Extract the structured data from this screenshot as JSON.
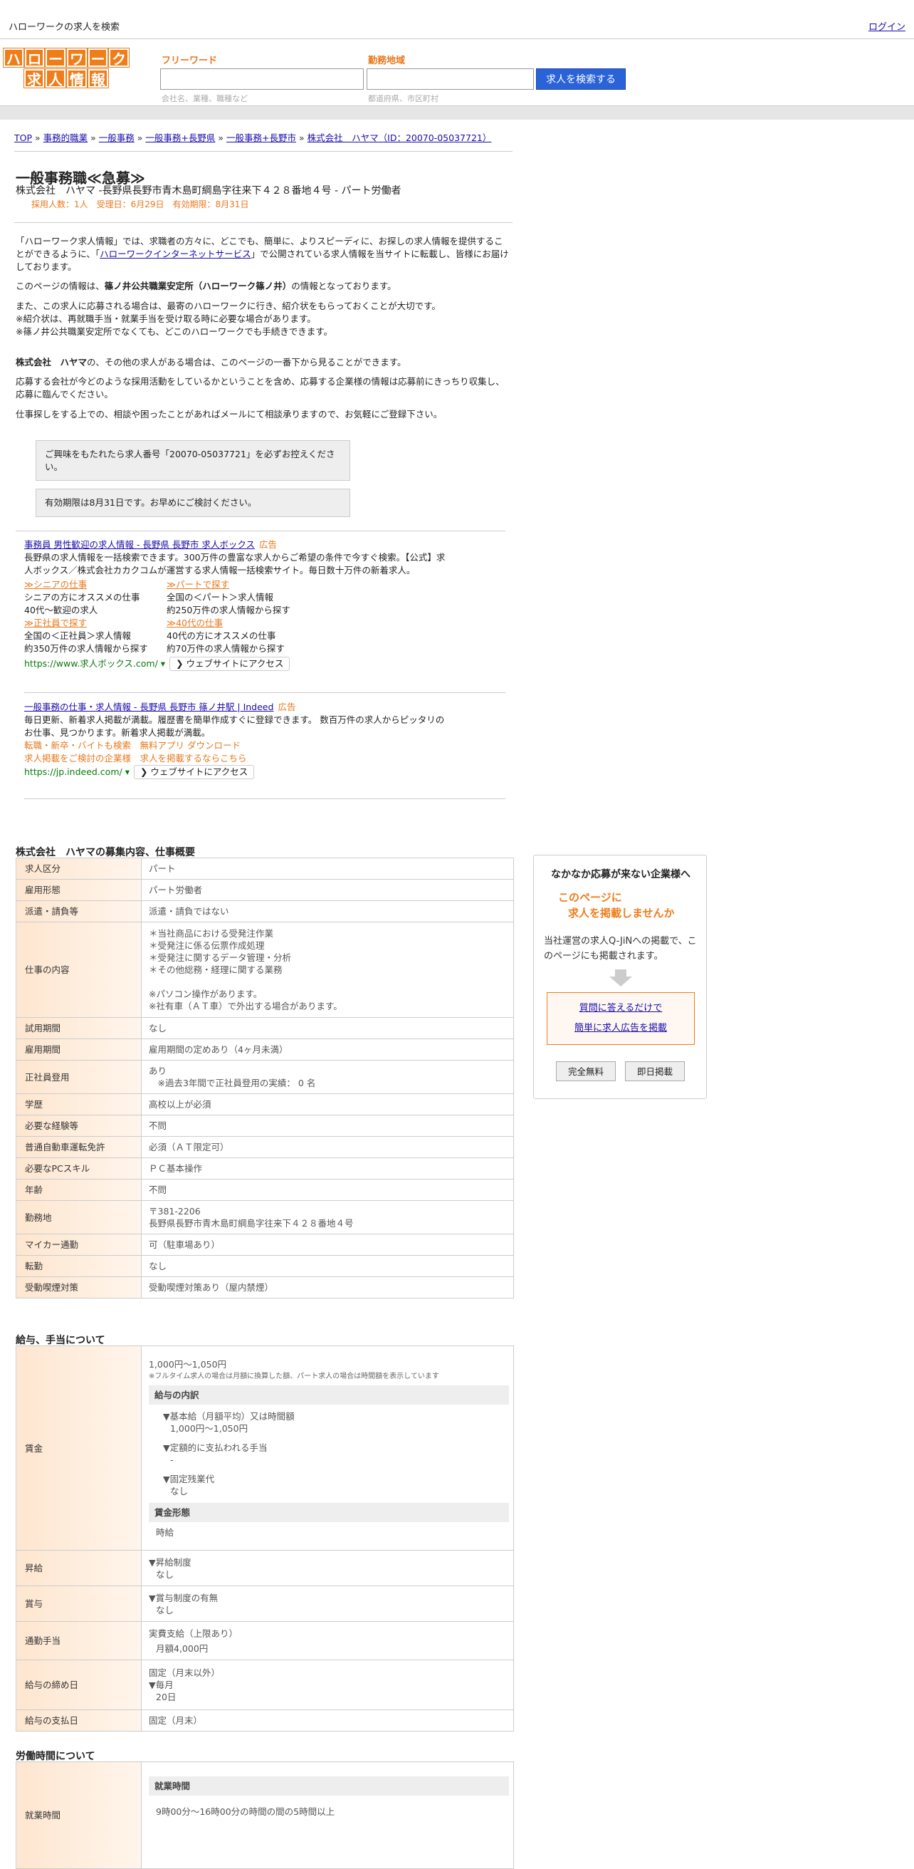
{
  "topbar": {
    "title": "ハローワークの求人を検索",
    "login": "ログイン"
  },
  "logo": {
    "row1": [
      "ハ",
      "ロ",
      "ー",
      "ワ",
      "ー",
      "ク"
    ],
    "row2": [
      "求",
      "人",
      "情",
      "報"
    ]
  },
  "search": {
    "freeword_label": "フリーワード",
    "freeword_placeholder": "会社名、業種、職種など",
    "area_label": "勤務地域",
    "area_placeholder": "都道府県、市区町村",
    "button": "求人を検索する"
  },
  "breadcrumb": [
    {
      "label": "TOP"
    },
    {
      "label": "事務的職業"
    },
    {
      "label": "一般事務"
    },
    {
      "label": "一般事務+長野県"
    },
    {
      "label": "一般事務+長野市"
    },
    {
      "label": "株式会社　ハヤマ（ID：20070-05037721）"
    }
  ],
  "breadcrumb_sep": "»",
  "job": {
    "title": "一般事務職≪急募≫",
    "company_line": "株式会社　ハヤマ -長野県長野市青木島町綱島字往来下４２８番地４号 - パート労働者",
    "meta": "採用人数：1人　受理日：6月29日　有効期限：8月31日"
  },
  "intro": {
    "p1a": "「ハローワーク求人情報」では、求職者の方々に、どこでも、簡単に、よりスピーディに、お探しの求人情報を提供することができるように、「",
    "p1link": "ハローワークインターネットサービス",
    "p1b": "」で公開されている求人情報を当サイトに転載し、皆様にお届けしております。",
    "p2a": "このページの情報は、",
    "p2b": "篠ノ井公共職業安定所（ハローワーク篠ノ井）",
    "p2c": "の情報となっております。",
    "p3": "また、この求人に応募される場合は、最寄のハローワークに行き、紹介状をもらっておくことが大切です。",
    "p4": "※紹介状は、再就職手当・就業手当を受け取る時に必要な場合があります。",
    "p5": "※篠ノ井公共職業安定所でなくても、どこのハローワークでも手続きできます。",
    "p6a": "株式会社　ハヤマ",
    "p6b": "の、その他の求人がある場合は、このページの一番下から見ることができます。",
    "p7": "応募する会社が今どのような採用活動をしているかということを含め、応募する企業様の情報は応募前にきっちり収集し、応募に臨んでください。",
    "p8": "仕事探しをする上での、相談や困ったことがあればメールにて相談承りますので、お気軽にご登録下さい。",
    "box1": "ご興味をもたれたら求人番号「20070-05037721」を必ずお控えください。",
    "box2": "有効期限は8月31日です。お早めにご検討ください。"
  },
  "ads": [
    {
      "title": "事務員 男性歓迎の求人情報 - 長野県 長野市 求人ボックス",
      "badge": "広告",
      "desc": "長野県の求人情報を一括検索できます。300万件の豊富な求人からご希望の条件で今すぐ検索。【公式】求人ボックス／株式会社カカクコムが運営する求人情報一括検索サイト。毎日数十万件の新着求人。",
      "subs": [
        {
          "t": "≫シニアの仕事",
          "d1": "シニアの方にオススメの仕事",
          "d2": "40代～歓迎の求人"
        },
        {
          "t": "≫パートで探す",
          "d1": "全国の＜パート＞求人情報",
          "d2": "約250万件の求人情報から探す"
        },
        {
          "t": "≫正社員で探す",
          "d1": "全国の＜正社員＞求人情報",
          "d2": "約350万件の求人情報から探す"
        },
        {
          "t": "≫40代の仕事",
          "d1": "40代の方にオススメの仕事",
          "d2": "約70万件の求人情報から探す"
        }
      ],
      "url": "https://www.求人ボックス.com/",
      "btn": "ウェブサイトにアクセス"
    },
    {
      "title": "一般事務の仕事・求人情報 - 長野県 長野市 篠ノ井駅 | Indeed",
      "badge": "広告",
      "desc": "毎日更新、新着求人掲載が満載。履歴書を簡単作成すぐに登録できます。 数百万件の求人からピッタリのお仕事、見つかります。新着求人掲載が満載。",
      "links1": "転職・新卒・バイトも検索　無料アプリ ダウンロード",
      "links2": "求人掲載をご検討の企業様　求人を掲載するならこちら",
      "url": "https://jp.indeed.com/",
      "btn": "ウェブサイトにアクセス"
    }
  ],
  "sections": {
    "overview": "株式会社　ハヤマの募集内容、仕事概要",
    "salary": "給与、手当について",
    "hours": "労働時間について"
  },
  "overview_rows": [
    {
      "k": "求人区分",
      "v": [
        "パート"
      ]
    },
    {
      "k": "雇用形態",
      "v": [
        "パート労働者"
      ]
    },
    {
      "k": "派遣・請負等",
      "v": [
        "派遣・請負ではない"
      ]
    },
    {
      "k": "仕事の内容",
      "v": [
        "＊当社商品における受発注作業",
        "＊受発注に係る伝票作成処理",
        "＊受発注に関するデータ管理・分析",
        "＊その他総務・経理に関する業務",
        "",
        "※パソコン操作があります。",
        "※社有車（ＡＴ車）で外出する場合があります。"
      ]
    },
    {
      "k": "試用期間",
      "v": [
        "なし"
      ]
    },
    {
      "k": "雇用期間",
      "v": [
        "雇用期間の定めあり（4ヶ月未満）"
      ]
    },
    {
      "k": "正社員登用",
      "v": [
        "あり",
        "　※過去3年間で正社員登用の実績： 0 名"
      ]
    },
    {
      "k": "学歴",
      "v": [
        "高校以上が必須"
      ]
    },
    {
      "k": "必要な経験等",
      "v": [
        "不問"
      ]
    },
    {
      "k": "普通自動車運転免許",
      "v": [
        "必須（ＡＴ限定可）"
      ]
    },
    {
      "k": "必要なPCスキル",
      "v": [
        "ＰＣ基本操作"
      ]
    },
    {
      "k": "年齢",
      "v": [
        "不問"
      ]
    },
    {
      "k": "勤務地",
      "v": [
        "〒381-2206",
        "長野県長野市青木島町綱島字往来下４２８番地４号"
      ]
    },
    {
      "k": "マイカー通勤",
      "v": [
        "可（駐車場あり）"
      ]
    },
    {
      "k": "転勤",
      "v": [
        "なし"
      ]
    },
    {
      "k": "受動喫煙対策",
      "v": [
        "受動喫煙対策あり（屋内禁煙）"
      ]
    }
  ],
  "salary": {
    "wage_k": "賃金",
    "wage_main": "1,000円〜1,050円",
    "wage_note": "※フルタイム求人の場合は月額に換算した額、パート求人の場合は時間額を表示しています",
    "breakdown_h": "給与の内訳",
    "b1t": "▼基本給（月額平均）又は時間額",
    "b1v": "1,000円〜1,050円",
    "b2t": "▼定額的に支払われる手当",
    "b2v": "-",
    "b3t": "▼固定残業代",
    "b3v": "なし",
    "form_h": "賃金形態",
    "form_v": "時給",
    "raise_k": "昇給",
    "raise_t": "▼昇給制度",
    "raise_v": "なし",
    "bonus_k": "賞与",
    "bonus_t": "▼賞与制度の有無",
    "bonus_v": "なし",
    "commute_k": "通勤手当",
    "commute_t": "実費支給（上限あり）",
    "commute_v": "月額4,000円",
    "close_k": "給与の締め日",
    "close_t": "固定（月末以外）",
    "close_t2": "▼毎月",
    "close_v": "20日",
    "pay_k": "給与の支払日",
    "pay_v": "固定（月末）"
  },
  "hours": {
    "k": "就業時間",
    "h": "就業時間",
    "v": "9時00分〜16時00分の時間の間の5時間以上"
  },
  "side": {
    "head": "なかなか応募が来ない企業様へ",
    "o1": "このページに",
    "o2": "求人を掲載しませんか",
    "desc": "当社運営の求人Q-JiNへの掲載で、このページにも掲載されます。",
    "link1": "質問に答えるだけで",
    "link2": "簡単に求人広告を掲載",
    "btn1": "完全無料",
    "btn2": "即日掲載"
  }
}
